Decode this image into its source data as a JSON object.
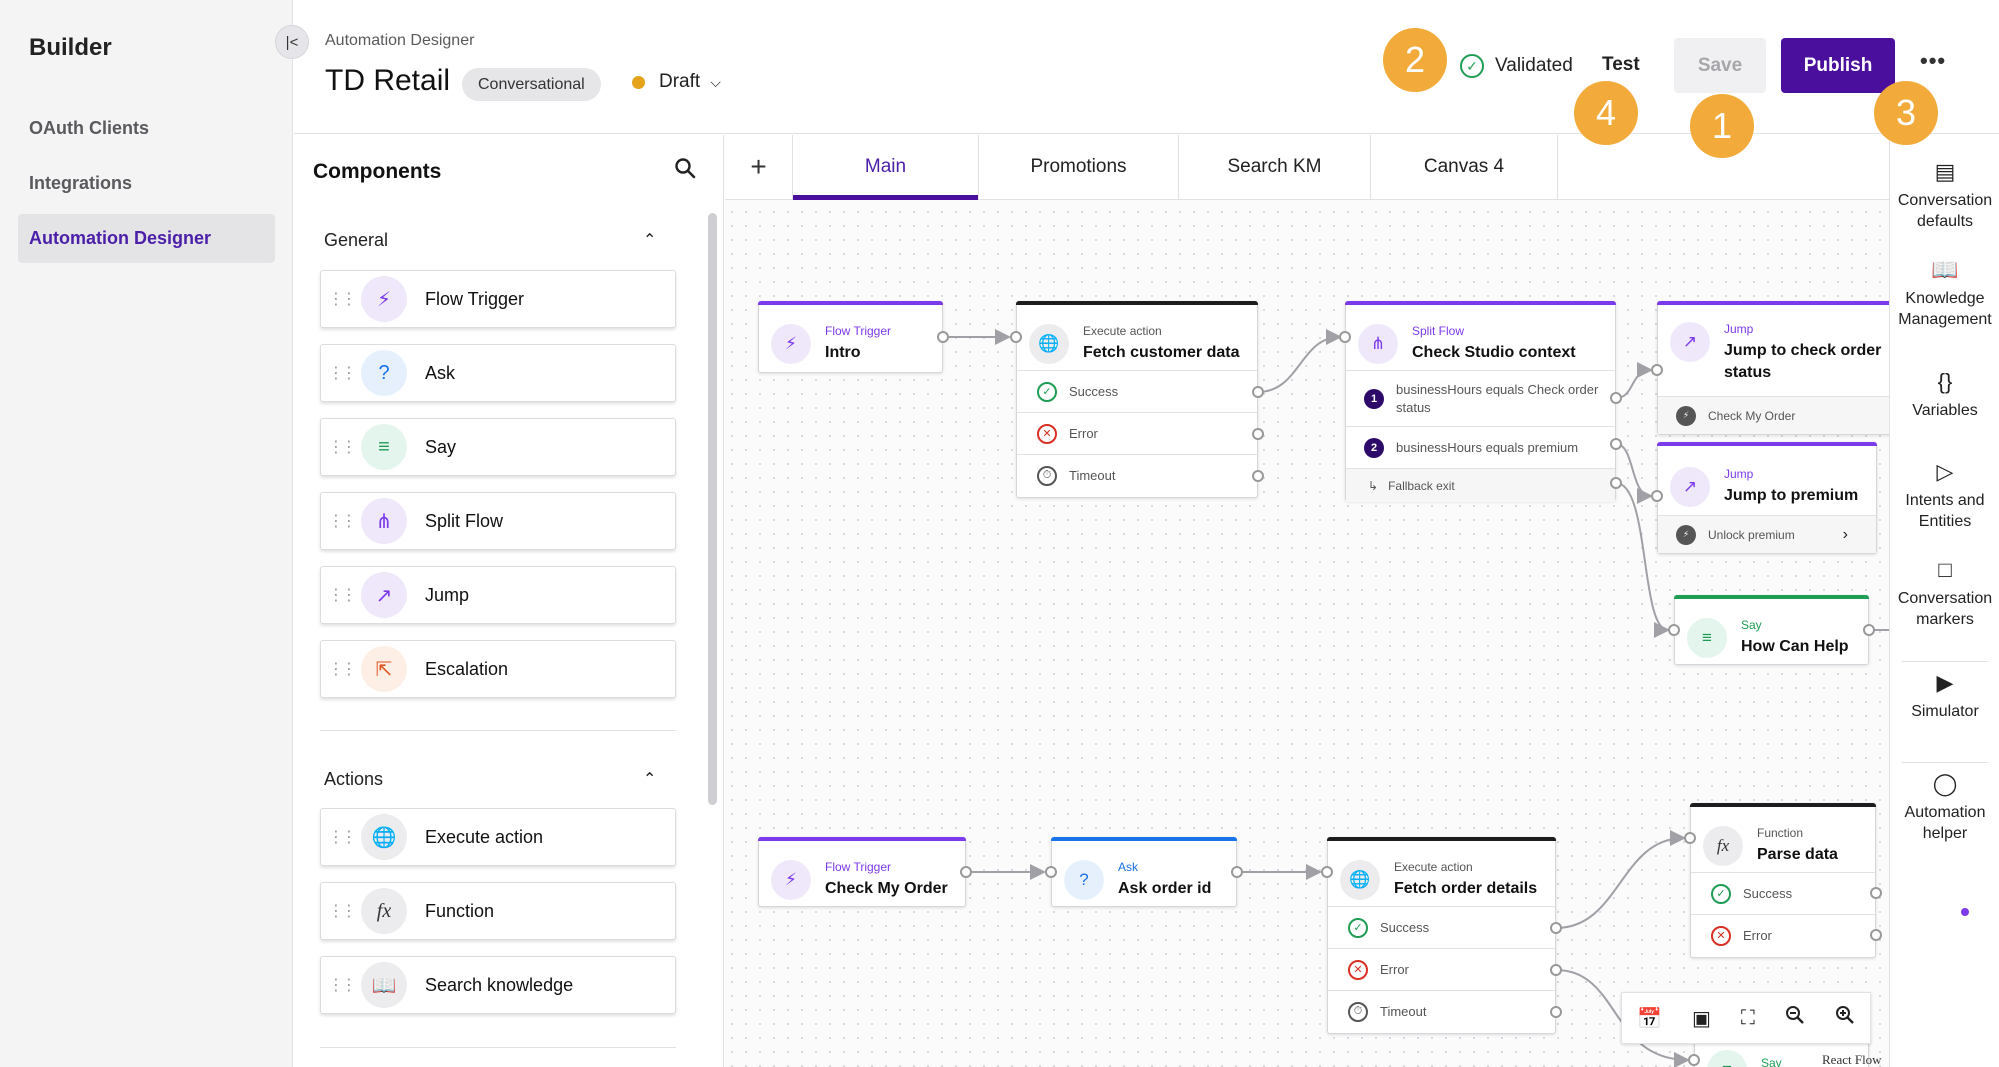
{
  "sidebar": {
    "brand": "Builder",
    "items": [
      {
        "label": "OAuth Clients"
      },
      {
        "label": "Integrations"
      },
      {
        "label": "Automation Designer"
      }
    ]
  },
  "header": {
    "breadcrumb": "Automation Designer",
    "title": "TD Retail",
    "type_pill": "Conversational",
    "status": "Draft",
    "validation": "Validated",
    "test_label": "Test",
    "save_label": "Save",
    "publish_label": "Publish",
    "more_label": "•••"
  },
  "callouts": [
    "2",
    "4",
    "1",
    "3"
  ],
  "components": {
    "heading": "Components",
    "sections": [
      {
        "title": "General",
        "items": [
          "Flow Trigger",
          "Ask",
          "Say",
          "Split Flow",
          "Jump",
          "Escalation"
        ]
      },
      {
        "title": "Actions",
        "items": [
          "Execute action",
          "Function",
          "Search knowledge"
        ]
      }
    ]
  },
  "tabs": [
    "Main",
    "Promotions",
    "Search KM",
    "Canvas 4"
  ],
  "nodes": {
    "intro": {
      "type": "Flow Trigger",
      "title": "Intro"
    },
    "fetch_customer": {
      "type": "Execute action",
      "title": "Fetch customer data",
      "rows": [
        "Success",
        "Error",
        "Timeout"
      ]
    },
    "check_studio": {
      "type": "Split Flow",
      "title": "Check Studio context",
      "rows": [
        "businessHours equals Check order status",
        "businessHours equals premium"
      ],
      "row_numbers": [
        "1",
        "2"
      ],
      "footer": "Fallback exit"
    },
    "jump_check": {
      "type": "Jump",
      "title": "Jump to check order status",
      "footer": "Check My Order"
    },
    "jump_premium": {
      "type": "Jump",
      "title": "Jump to premium",
      "footer": "Unlock premium"
    },
    "how_can_help": {
      "type": "Say",
      "title": "How Can Help"
    },
    "check_my_order": {
      "type": "Flow Trigger",
      "title": "Check My Order"
    },
    "ask_order": {
      "type": "Ask",
      "title": "Ask order id"
    },
    "fetch_order": {
      "type": "Execute action",
      "title": "Fetch order details",
      "rows": [
        "Success",
        "Error",
        "Timeout"
      ]
    },
    "parse_data": {
      "type": "Function",
      "title": "Parse data",
      "rows": [
        "Success",
        "Error"
      ]
    },
    "say_bottom": {
      "type": "Say"
    }
  },
  "canvas_footer": "React Flow",
  "rail": [
    {
      "label": "Conversation defaults"
    },
    {
      "label": "Knowledge Management"
    },
    {
      "label": "Variables"
    },
    {
      "label": "Intents and Entities"
    },
    {
      "label": "Conversation markers"
    },
    {
      "label": "Simulator"
    },
    {
      "label": "Automation helper"
    }
  ],
  "colors": {
    "accent": "#4b0f9e",
    "badge": "#f2ab3a",
    "draft": "#e5a21b",
    "success": "#1f9d55",
    "error": "#d93025"
  }
}
